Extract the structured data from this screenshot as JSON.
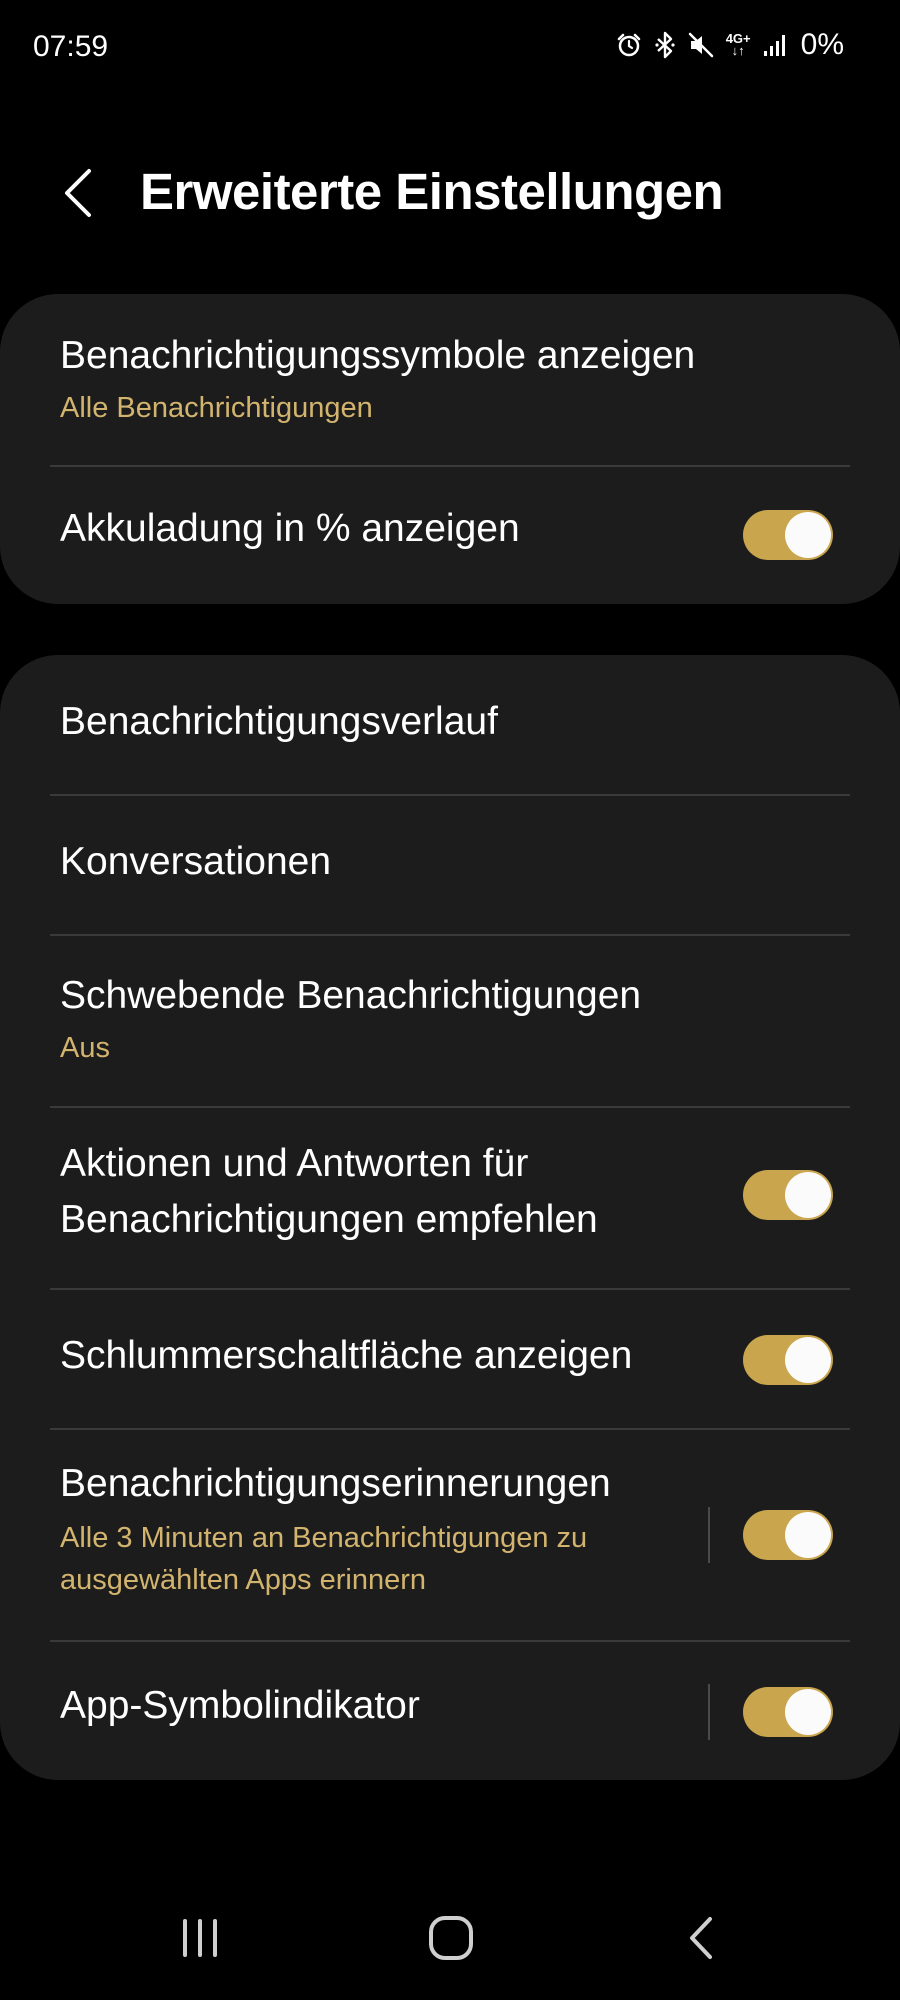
{
  "status_bar": {
    "time": "07:59",
    "network": "4G+",
    "battery": "0%",
    "icons": [
      "alarm-icon",
      "bluetooth-icon",
      "mute-icon",
      "network-4g-icon",
      "signal-icon"
    ]
  },
  "header": {
    "title": "Erweiterte Einstellungen",
    "back_icon": "chevron-left-icon"
  },
  "group1": {
    "items": [
      {
        "title": "Benachrichtigungssymbole anzeigen",
        "subtitle": "Alle Benachrichtigungen"
      },
      {
        "title": "Akkuladung in % anzeigen",
        "toggle": true
      }
    ]
  },
  "group2": {
    "items": [
      {
        "title": "Benachrichtigungsverlauf"
      },
      {
        "title": "Konversationen"
      },
      {
        "title": "Schwebende Benachrichtigungen",
        "subtitle": "Aus"
      },
      {
        "title_line1": "Aktionen und Antworten für",
        "title_line2": "Benachrichtigungen empfehlen",
        "toggle": true
      },
      {
        "title": "Schlummerschaltfläche anzeigen",
        "toggle": true
      },
      {
        "title": "Benachrichtigungserinnerungen",
        "subtitle_line1": "Alle 3 Minuten an Benachrichtigungen zu",
        "subtitle_line2": "ausgewählten Apps erinnern",
        "toggle": true
      },
      {
        "title": "App-Symbolindikator",
        "toggle": true
      }
    ]
  },
  "nav_bar": {
    "icons": [
      "recents-icon",
      "home-icon",
      "back-icon"
    ]
  },
  "colors": {
    "background": "#000000",
    "card": "#1c1c1c",
    "accent": "#c9a54e",
    "subtitle": "#d2b46e",
    "divider": "#3a3a3a"
  }
}
